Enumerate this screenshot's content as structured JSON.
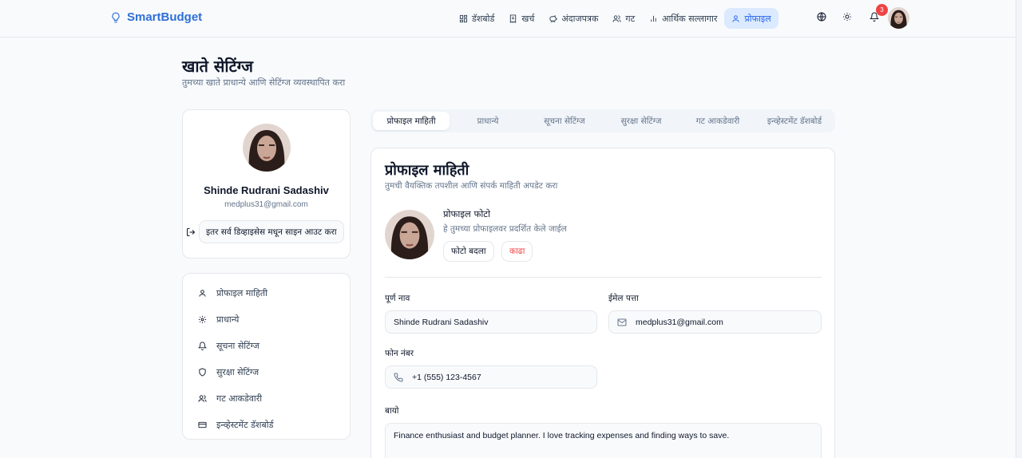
{
  "brand": {
    "name": "SmartBudget",
    "icon": "lightbulb-icon"
  },
  "nav": {
    "items": [
      {
        "label": "डॅशबोर्ड",
        "icon": "dashboard-icon"
      },
      {
        "label": "खर्च",
        "icon": "receipt-icon"
      },
      {
        "label": "अंदाजपत्रक",
        "icon": "piggy-bank-icon"
      },
      {
        "label": "गट",
        "icon": "users-icon"
      },
      {
        "label": "आर्थिक सल्लागार",
        "icon": "bar-chart-icon"
      },
      {
        "label": "प्रोफाइल",
        "icon": "user-icon",
        "active": true
      }
    ],
    "notification_count": "3"
  },
  "page": {
    "title": "खाते सेटिंग्ज",
    "subtitle": "तुमच्या खाते प्राधान्ये आणि सेटिंग्ज व्यवस्थापित करा"
  },
  "profile_card": {
    "name": "Shinde Rudrani Sadashiv",
    "email": "medplus31@gmail.com",
    "signout_label": "इतर सर्व डिव्हाइसेस मधून साइन आउट करा"
  },
  "side_menu": [
    {
      "label": "प्रोफाइल माहिती",
      "icon": "user-icon"
    },
    {
      "label": "प्राधान्ये",
      "icon": "gear-icon"
    },
    {
      "label": "सूचना सेटिंग्ज",
      "icon": "bell-icon"
    },
    {
      "label": "सुरक्षा सेटिंग्ज",
      "icon": "shield-icon"
    },
    {
      "label": "गट आकडेवारी",
      "icon": "users-icon"
    },
    {
      "label": "इन्व्हेस्टमेंट डॅशबोर्ड",
      "icon": "credit-card-icon"
    }
  ],
  "tabs": [
    {
      "label": "प्रोफाइल माहिती",
      "active": true
    },
    {
      "label": "प्राधान्ये"
    },
    {
      "label": "सूचना सेटिंग्ज"
    },
    {
      "label": "सुरक्षा सेटिंग्ज"
    },
    {
      "label": "गट आकडेवारी"
    },
    {
      "label": "इन्व्हेस्टमेंट डॅशबोर्ड"
    }
  ],
  "main": {
    "title": "प्रोफाइल माहिती",
    "subtitle": "तुमची वैयक्तिक तपशील आणि संपर्क माहिती अपडेट करा",
    "photo": {
      "title": "प्रोफाइल फोटो",
      "subtitle": "हे तुमच्या प्रोफाइलवर प्रदर्शित केले जाईल",
      "change_label": "फोटो बदला",
      "remove_label": "काढा"
    },
    "fields": {
      "full_name": {
        "label": "पूर्ण नाव",
        "value": "Shinde Rudrani Sadashiv"
      },
      "email": {
        "label": "ईमेल पत्ता",
        "value": "medplus31@gmail.com"
      },
      "phone": {
        "label": "फोन नंबर",
        "value": "+1 (555) 123-4567"
      },
      "bio": {
        "label": "बायो",
        "value": "Finance enthusiast and budget planner. I love tracking expenses and finding ways to save."
      }
    }
  },
  "colors": {
    "accent": "#2563eb",
    "danger": "#ef4444",
    "brand": "#2f6fd6"
  }
}
